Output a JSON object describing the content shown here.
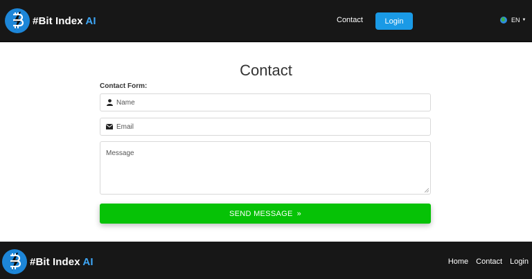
{
  "header": {
    "logo_prefix": "#Bit Index",
    "logo_suffix": "AI",
    "nav_contact": "Contact",
    "login_label": "Login",
    "language": "EN"
  },
  "main": {
    "title": "Contact",
    "form_label": "Contact Form:",
    "name_placeholder": "Name",
    "email_placeholder": "Email",
    "message_placeholder": "Message",
    "send_label": "SEND MESSAGE",
    "send_arrows": "»"
  },
  "footer": {
    "logo_prefix": "#Bit Index",
    "logo_suffix": "AI",
    "links": [
      "Home",
      "Contact",
      "Login"
    ]
  },
  "icons": {
    "logo": "bitcoin-runner-logo-icon",
    "language": "globe-icon",
    "name": "user-icon",
    "email": "envelope-icon"
  },
  "colors": {
    "header_bg": "#171717",
    "accent_blue": "#1a9ae6",
    "logo_ai": "#3ea6f5",
    "send_green": "#06c206"
  }
}
